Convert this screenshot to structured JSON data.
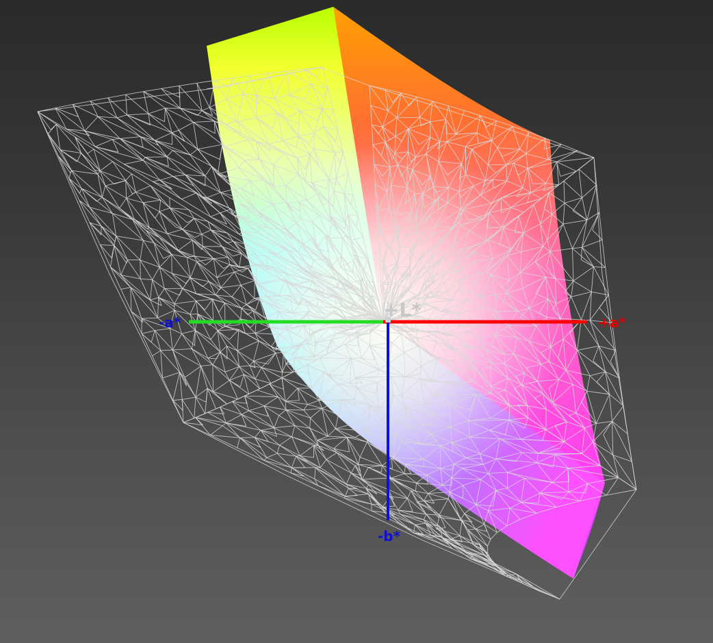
{
  "axes": {
    "plus_l": {
      "label": "+L*",
      "color": "#c8c8c8"
    },
    "plus_a": {
      "label": "+a*",
      "color": "#e00000"
    },
    "minus_a": {
      "label": "-a*",
      "color": "#1010d0"
    },
    "minus_b": {
      "label": "-b*",
      "color": "#1010d0"
    },
    "green_axis_color": "#22dd22",
    "red_axis_color": "#ff0000",
    "blue_axis_color": "#1010e0"
  },
  "gamut_colors": {
    "yellow": "#ffff00",
    "yellow_green": "#aaff00",
    "orange": "#ffa000",
    "red_orange": "#ff6020",
    "cyan": "#80ffff",
    "blue": "#90a0ff",
    "magenta": "#ff40ff",
    "violet": "#a040ff",
    "white_point": "#fffff0"
  },
  "wireframe_color": "#d8d8d8"
}
